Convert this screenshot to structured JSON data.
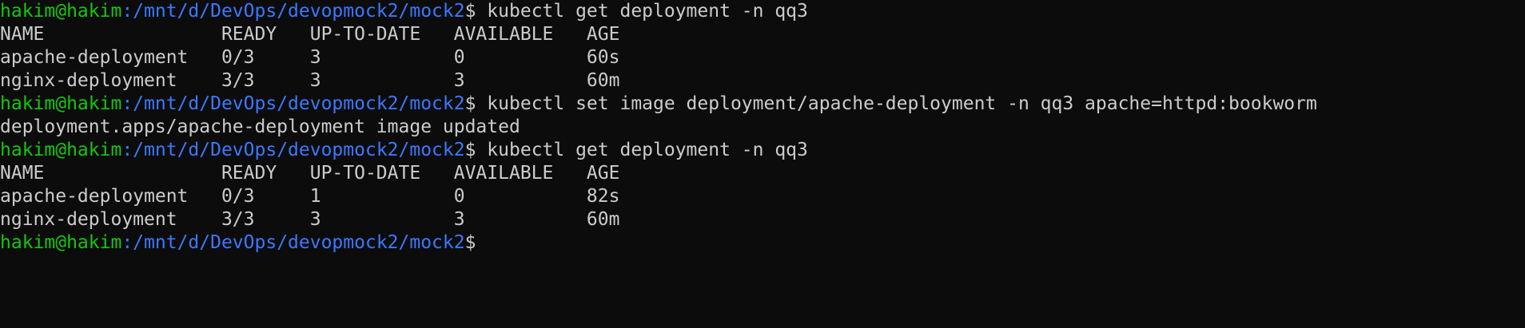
{
  "prompt": {
    "user_host": "hakim@hakim",
    "path": ":/mnt/d/DevOps/devopmock2/mock2",
    "symbol": "$"
  },
  "commands": {
    "cmd1": " kubectl get deployment -n qq3",
    "cmd2": " kubectl set image deployment/apache-deployment -n qq3 apache=httpd:bookworm",
    "cmd3": " kubectl get deployment -n qq3",
    "cmd4": ""
  },
  "output": {
    "table1": {
      "header": "NAME                READY   UP-TO-DATE   AVAILABLE   AGE",
      "rows": [
        "apache-deployment   0/3     3            0           60s",
        "nginx-deployment    3/3     3            3           60m"
      ]
    },
    "set_image_result": "deployment.apps/apache-deployment image updated",
    "table2": {
      "header": "NAME                READY   UP-TO-DATE   AVAILABLE   AGE",
      "rows": [
        "apache-deployment   0/3     1            0           82s",
        "nginx-deployment    3/3     3            3           60m"
      ]
    }
  },
  "colors": {
    "background": "#0c0c0c",
    "text": "#cccccc",
    "user_host": "#16c60c",
    "path": "#3b78ff"
  }
}
